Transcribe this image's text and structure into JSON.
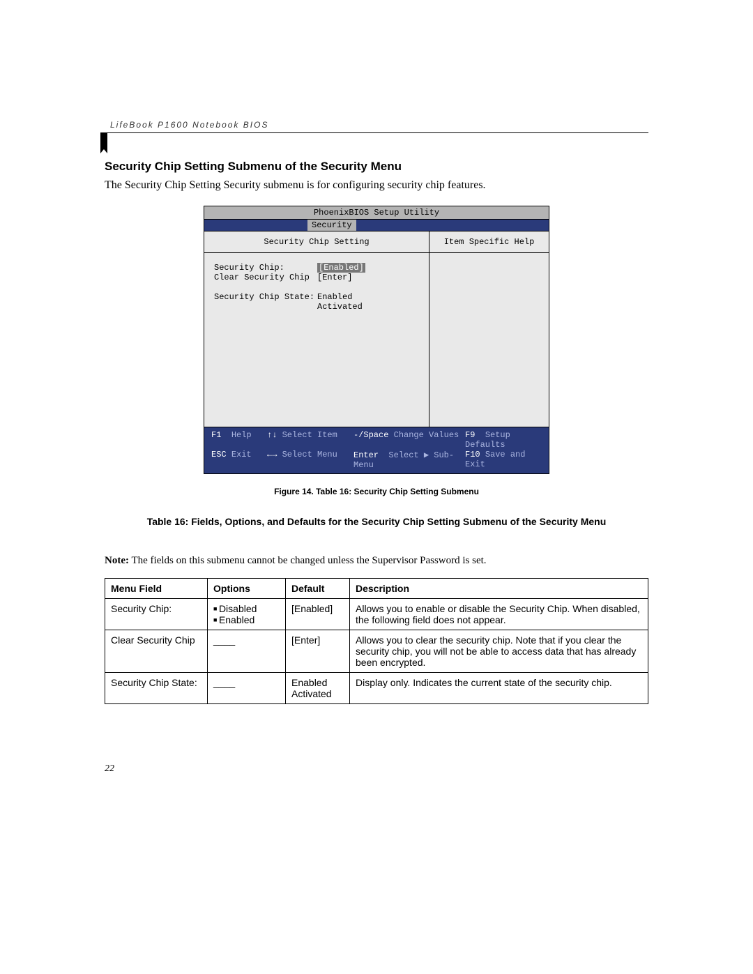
{
  "header": {
    "running_head": "LifeBook P1600 Notebook BIOS"
  },
  "section": {
    "title": "Security Chip Setting Submenu of the Security Menu",
    "intro": "The Security Chip Setting Security submenu is for configuring security chip features."
  },
  "bios": {
    "utility_title": "PhoenixBIOS Setup Utility",
    "active_tab": "Security",
    "left_heading": "Security Chip Setting",
    "right_heading": "Item Specific Help",
    "fields": {
      "security_chip_label": "Security Chip:",
      "security_chip_value": "[Enabled]",
      "clear_chip_label": "Clear Security Chip",
      "clear_chip_value": "[Enter]",
      "state_label": "Security Chip State:",
      "state_value1": "Enabled",
      "state_value2": "Activated"
    },
    "footer": {
      "f1": "F1",
      "help": "Help",
      "arrows_ud": "↑↓",
      "select_item": "Select Item",
      "minus_space": "-/Space",
      "change_values": "Change Values",
      "f9": "F9",
      "setup_defaults": "Setup Defaults",
      "esc": "ESC",
      "exit": "Exit",
      "arrows_lr": "←→",
      "select_menu": "Select Menu",
      "enter": "Enter",
      "select_submenu": "Select ▶ Sub-Menu",
      "f10": "F10",
      "save_exit": "Save and Exit"
    }
  },
  "figure_caption": "Figure 14.  Table 16: Security Chip Setting Submenu",
  "table_title": "Table 16: Fields, Options, and Defaults for the Security Chip Setting Submenu of the Security Menu",
  "note": {
    "label": "Note:",
    "text": " The fields on this submenu cannot be changed unless the Supervisor Password is set."
  },
  "table": {
    "head": {
      "menu_field": "Menu Field",
      "options": "Options",
      "default": "Default",
      "description": "Description"
    },
    "rows": [
      {
        "menu_field": "Security Chip:",
        "options": [
          "Disabled",
          "Enabled"
        ],
        "default": "[Enabled]",
        "description": "Allows you to enable or disable the Security Chip. When disabled, the following field does not appear."
      },
      {
        "menu_field": "Clear Security Chip",
        "options_blank": "____",
        "default": "[Enter]",
        "description": "Allows you to clear the security chip. Note that if you clear the security chip, you will not be able to access data that has already been encrypted."
      },
      {
        "menu_field": "Security Chip State:",
        "options_blank": "____",
        "default": "Enabled Activated",
        "description": "Display only. Indicates the current state of the security chip."
      }
    ]
  },
  "page_number": "22"
}
